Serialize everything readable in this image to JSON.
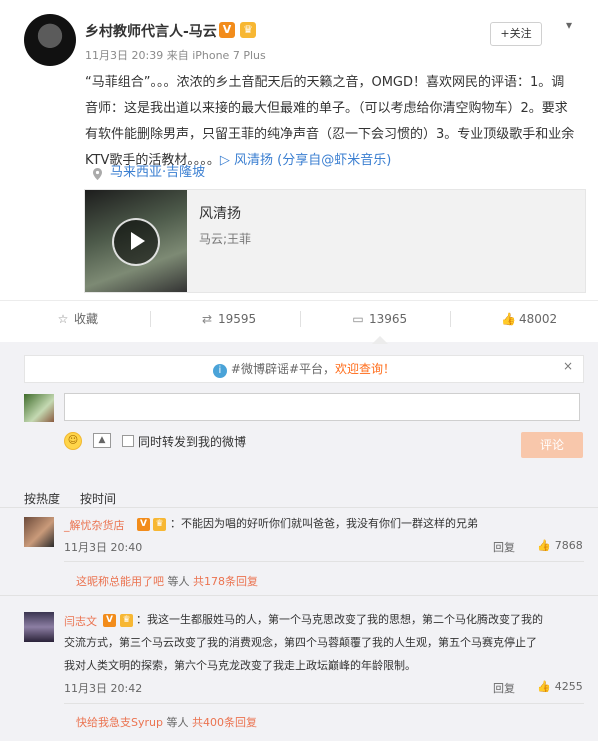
{
  "post": {
    "author": "乡村教师代言人-马云",
    "verified_badge": "V",
    "crown_badge": "♛",
    "time": "11月3日 20:39",
    "source": "来自 iPhone 7 Plus",
    "follow_label": "+关注",
    "more_icon": "chevron-down-icon",
    "text_main": "“马菲组合”。。。浓浓的乡土音配天后的天籁之音，OMGD！喜欢网民的评语：1。调音师：这是我出道以来接的最大但最难的单子。（可以考虑给你清空购物车）2。要求有软件能删除男声，只留王菲的纯净声音（忍一下会习惯的）3。专业顶级歌手和业余KTV歌手的活教材。。。。",
    "share_link": "▷ 风清扬",
    "share_suffix": " (分享自@虾米音乐)",
    "location": "马来西亚·吉隆坡",
    "media": {
      "title": "风清扬",
      "subtitle": "马云;王菲"
    }
  },
  "actions": {
    "favorite_label": "收藏",
    "repost_count": "19595",
    "comment_count": "13965",
    "like_count": "48002"
  },
  "notice": {
    "topic": "#微博辟谣#平台，",
    "welcome": "欢迎查询！",
    "close": "×"
  },
  "composer": {
    "input_value": "",
    "repost_label": "同时转发到我的微博",
    "submit_label": "评论"
  },
  "sort": {
    "hot_label": "按热度",
    "time_label": "按时间"
  },
  "comments": [
    {
      "name": "_解忧杂货店",
      "text": "：不能因为唱的好听你们就叫爸爸，我没有你们一群这样的兄弟",
      "time": "11月3日 20:40",
      "reply": "回复",
      "likes": "7868",
      "sub_prefix": "这昵称总能用了吧",
      "sub_mid": " 等人 ",
      "sub_count": "共178条回复"
    },
    {
      "name": "闫志文",
      "text_line1": "：我这一生都服姓马的人，第一个马克思改变了我的思想，第二个马化腾改变了我的",
      "text_line2": "交流方式，第三个马云改变了我的消费观念，第四个马蓉颠覆了我的人生观，第五个马赛克停止了",
      "text_line3": "我对人类文明的探索，第六个马克龙改变了我走上政坛巅峰的年龄限制。",
      "time": "11月3日 20:42",
      "reply": "回复",
      "likes": "4255",
      "sub_prefix": "快给我急支Syrup",
      "sub_mid": " 等人 ",
      "sub_count": "共400条回复"
    }
  ]
}
